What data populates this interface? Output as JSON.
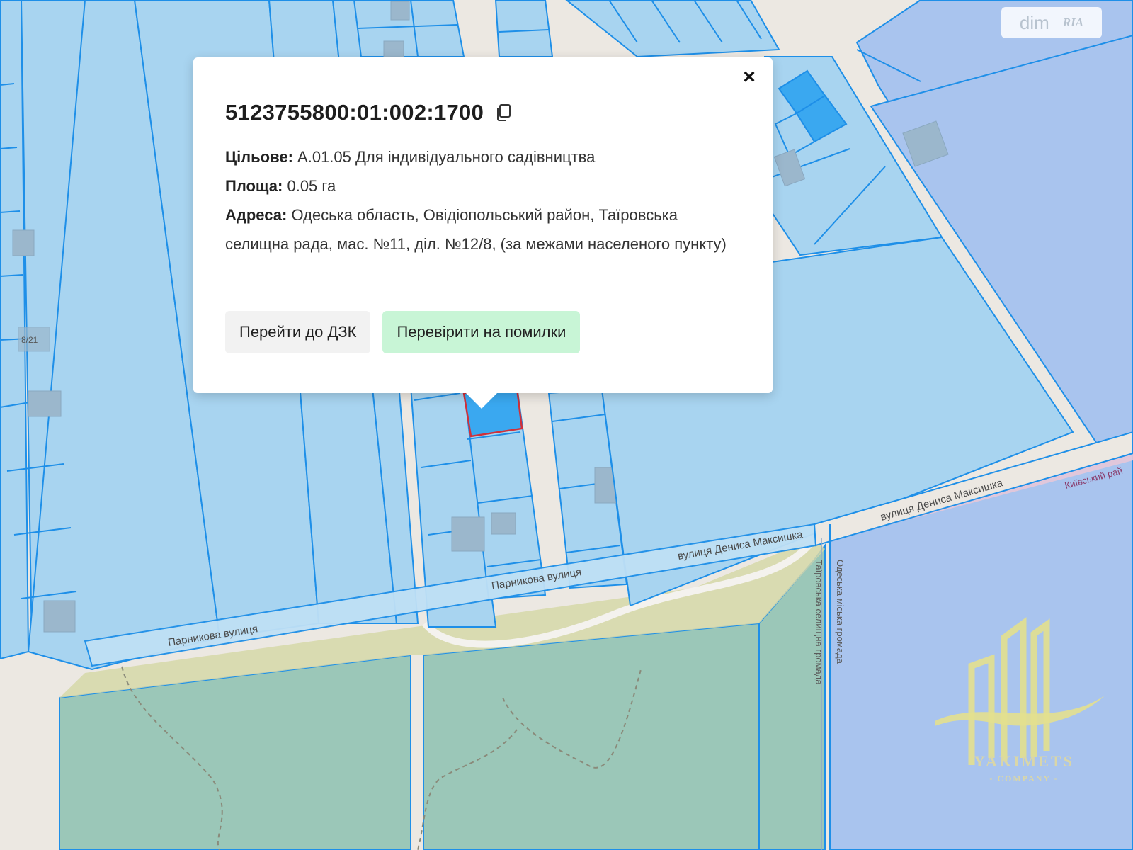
{
  "popup": {
    "cadastral_number": "5123755800:01:002:1700",
    "purpose_label": "Цільове:",
    "purpose_value": "А.01.05 Для індивідуального садівництва",
    "area_label": "Площа:",
    "area_value": "0.05 га",
    "address_label": "Адреса:",
    "address_value": "Одеська область, Овідіопольський район, Таїровська селищна рада, мас. №11, діл. №12/8, (за межами населеного пункту)",
    "btn_dzk": "Перейти до ДЗК",
    "btn_check": "Перевірити на помилки",
    "close_symbol": "×"
  },
  "map_labels": {
    "street_parnykova_1": "Парникова вулиця",
    "street_parnykova_2": "Парникова вулиця",
    "street_maksyshka_1": "вулиця Дениса Максишка",
    "street_maksyshka_2": "вулиця Дениса Максишка",
    "district_kyivskyi": "Київський рай",
    "boundary_tairovska": "Таїровська селищна громада",
    "boundary_odeska": "Одеська міська громада",
    "plot_number": "8/21"
  },
  "badge": {
    "dim": "dim",
    "ria": "RIA"
  },
  "watermark": {
    "name": "YAKIMETS",
    "sub": "- COMPANY -"
  },
  "colors": {
    "parcel_fill": "#a8d4f0",
    "parcel_stroke": "#1e8fe8",
    "selected_fill": "#3aa8f0",
    "selected_stroke": "#d0303a",
    "park_fill": "#9bc7b8",
    "sand_fill": "#d6d8a8",
    "municipal_fill": "#a9c4ee",
    "road_fill": "#ece8e2",
    "button_green": "#c8f5d6"
  }
}
